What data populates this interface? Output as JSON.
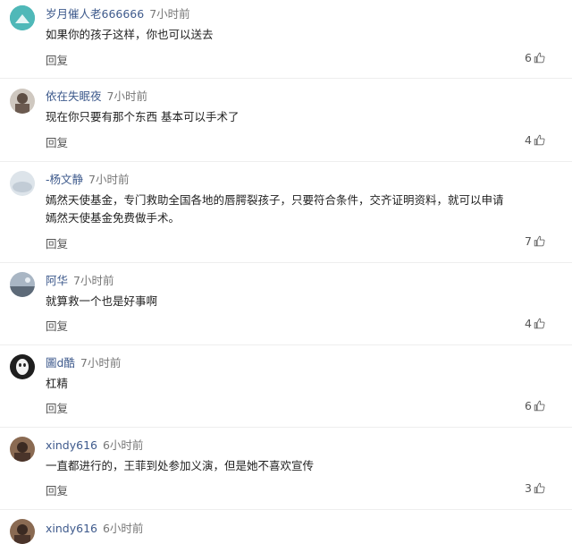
{
  "reply_label": "回复",
  "comments": [
    {
      "user": "岁月催人老666666",
      "time": "7小时前",
      "text": [
        "如果你的孩子这样，你也可以送去"
      ],
      "likes": "6",
      "avatar_color": "#4fb8b8"
    },
    {
      "user": "依在失眠夜",
      "time": "7小时前",
      "text": [
        "现在你只要有那个东西 基本可以手术了"
      ],
      "likes": "4",
      "avatar_color": "#7a6a5e"
    },
    {
      "user": "-杨文静",
      "time": "7小时前",
      "text": [
        "嫣然天使基金，专门救助全国各地的唇腭裂孩子，只要符合条件，交齐证明资料，就可以申请",
        "嫣然天使基金免费做手术。"
      ],
      "likes": "7",
      "avatar_color": "#c9d3dc"
    },
    {
      "user": "阿华",
      "time": "7小时前",
      "text": [
        "就算救一个也是好事啊"
      ],
      "likes": "4",
      "avatar_color": "#8796a6"
    },
    {
      "user": "圖d酷",
      "time": "7小时前",
      "text": [
        "杠精"
      ],
      "likes": "6",
      "avatar_color": "#222222"
    },
    {
      "user": "xindy616",
      "time": "6小时前",
      "text": [
        "一直都进行的，王菲到处参加义演，但是她不喜欢宣传"
      ],
      "likes": "3",
      "avatar_color": "#6b4a3a"
    },
    {
      "user": "xindy616",
      "time": "6小时前",
      "text": [],
      "likes": "",
      "avatar_color": "#6b4a3a"
    }
  ]
}
